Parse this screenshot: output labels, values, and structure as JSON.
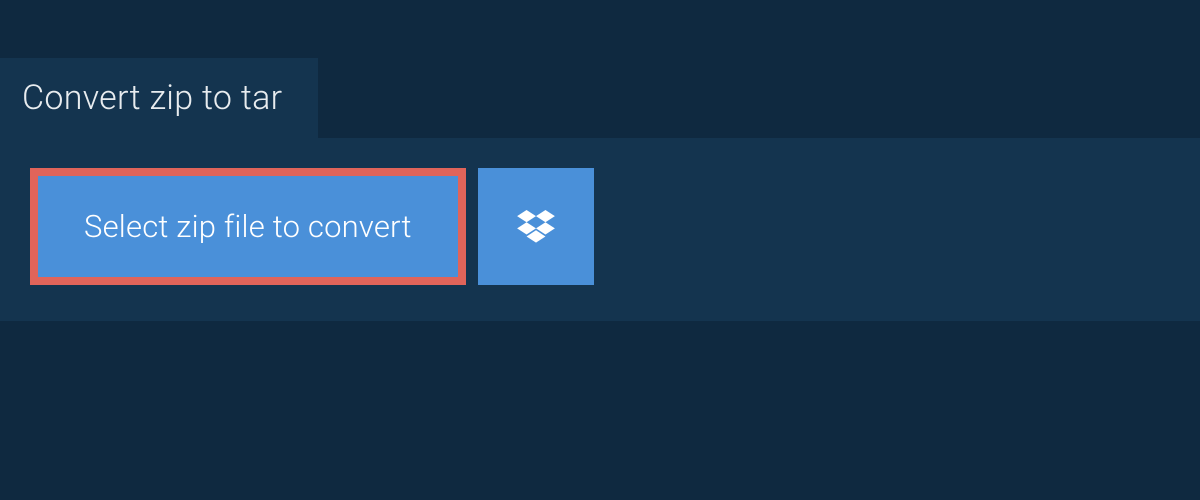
{
  "tab": {
    "title": "Convert zip to tar"
  },
  "actions": {
    "select_file_label": "Select zip file to convert"
  },
  "colors": {
    "background": "#0f2940",
    "panel": "#14344f",
    "button": "#4a90d9",
    "highlight_border": "#e0645a",
    "text_light": "#e8ecef",
    "text_white": "#ffffff"
  }
}
